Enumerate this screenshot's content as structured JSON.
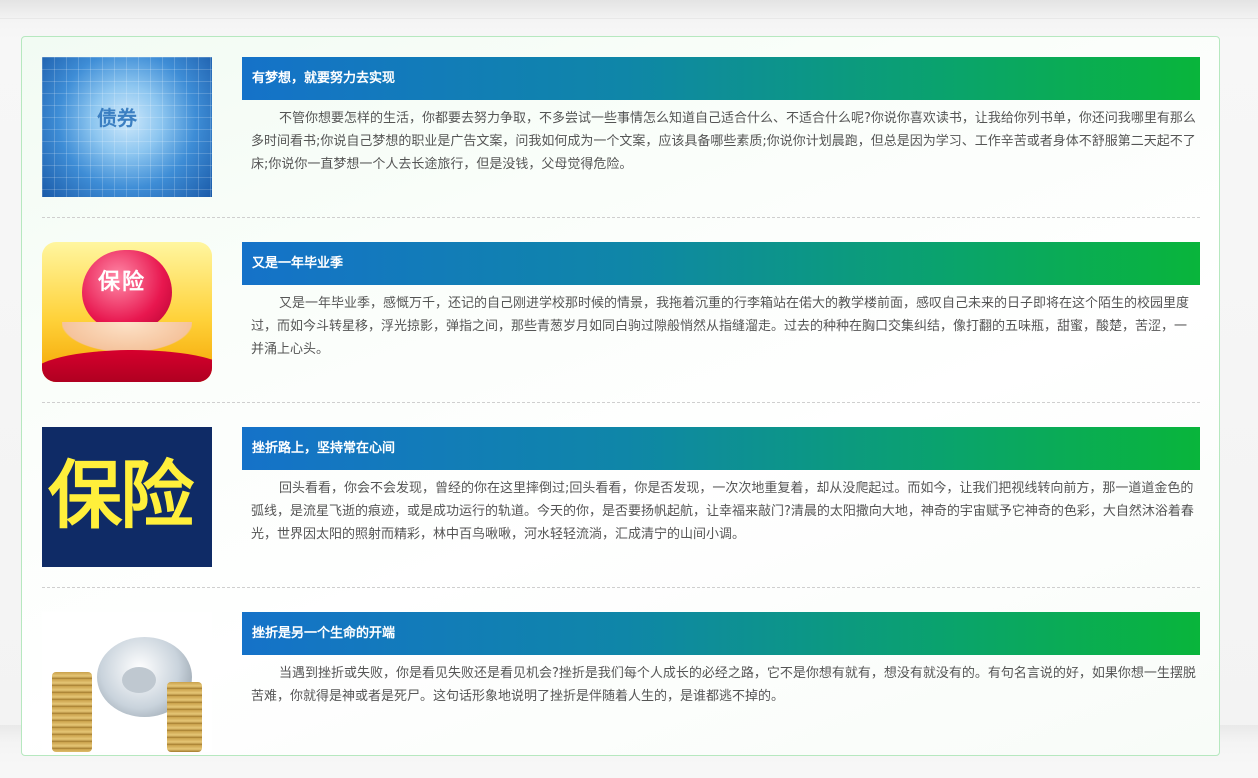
{
  "articles": [
    {
      "title": "有梦想，就要努力去实现",
      "image_label": "债券",
      "image_icon": "bonds-image",
      "text": "不管你想要怎样的生活，你都要去努力争取，不多尝试一些事情怎么知道自己适合什么、不适合什么呢?你说你喜欢读书，让我给你列书单，你还问我哪里有那么多时间看书;你说自己梦想的职业是广告文案，问我如何成为一个文案，应该具备哪些素质;你说你计划晨跑，但总是因为学习、工作辛苦或者身体不舒服第二天起不了床;你说你一直梦想一个人去长途旅行，但是没钱，父母觉得危险。"
    },
    {
      "title": "又是一年毕业季",
      "image_label": "保险",
      "image_icon": "heart-hands-image",
      "text": "又是一年毕业季，感慨万千，还记的自己刚进学校那时候的情景，我拖着沉重的行李箱站在偌大的教学楼前面，感叹自己未来的日子即将在这个陌生的校园里度过，而如今斗转星移，浮光掠影，弹指之间，那些青葱岁月如同白驹过隙般悄然从指缝溜走。过去的种种在胸口交集纠结，像打翻的五味瓶，甜蜜，酸楚，苦涩，一并涌上心头。"
    },
    {
      "title": "挫折路上，坚持常在心间",
      "image_label": "保险",
      "image_icon": "insurance-text-image",
      "text": "回头看看，你会不会发现，曾经的你在这里摔倒过;回头看看，你是否发现，一次次地重复着，却从没爬起过。而如今，让我们把视线转向前方，那一道道金色的弧线，是流星飞逝的痕迹，或是成功运行的轨道。今天的你，是否要扬帆起航，让幸福来敲门?清晨的太阳撒向大地，神奇的宇宙赋予它神奇的色彩，大自然沐浴着春光，世界因太阳的照射而精彩，林中百鸟啾啾，河水轻轻流淌，汇成清宁的山间小调。"
    },
    {
      "title": "挫折是另一个生命的开端",
      "image_label": "",
      "image_icon": "piggy-bank-image",
      "text": "当遇到挫折或失败，你是看见失败还是看见机会?挫折是我们每个人成长的必经之路，它不是你想有就有，想没有就没有的。有句名言说的好，如果你想一生摆脱苦难，你就得是神或者是死尸。这句话形象地说明了挫折是伴随着人生的，是谁都逃不掉的。"
    }
  ]
}
